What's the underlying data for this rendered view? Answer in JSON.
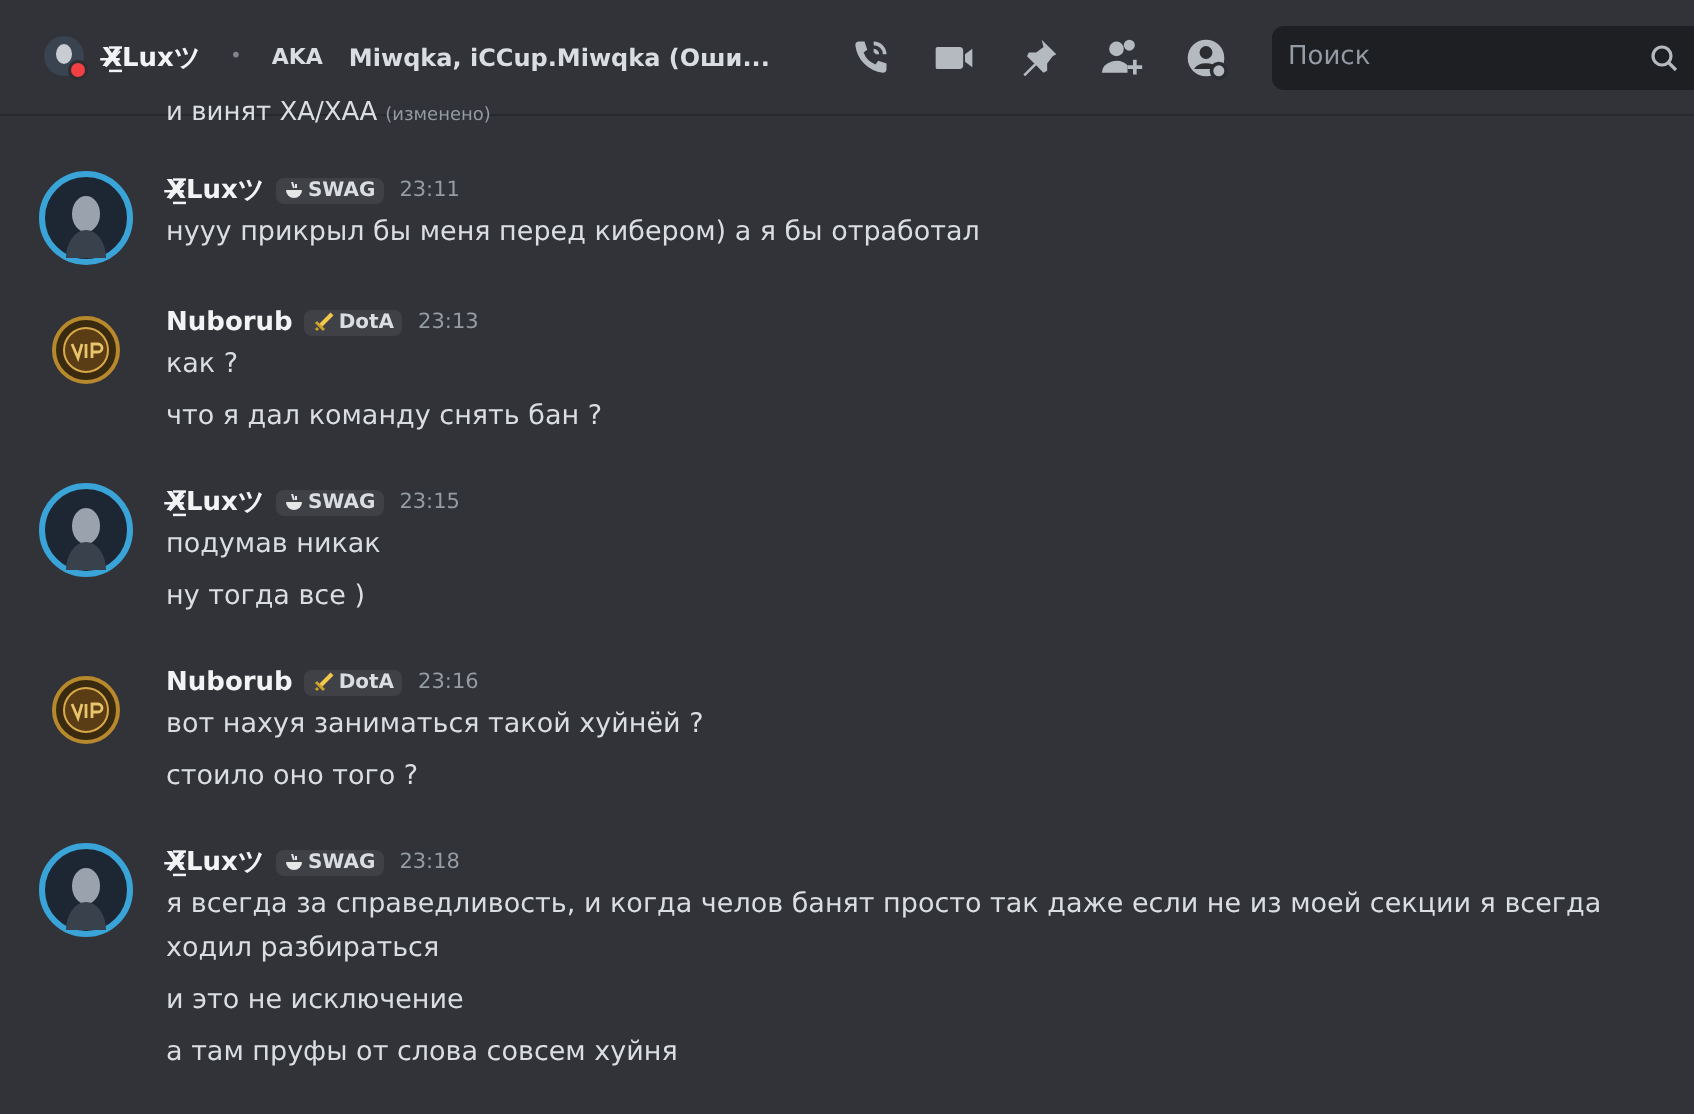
{
  "header": {
    "name": "X̶̷̲̅Luxツ",
    "status_dot": {
      "color": "#f23f43"
    },
    "separator": "•",
    "aka_label": "AKA",
    "aka_names": "Miwqka, iCCup.Miwqka (Оши...",
    "search": {
      "placeholder": "Поиск"
    }
  },
  "previous_line": {
    "text": "и винят ХА/ХАА",
    "edited": "(изменено)"
  },
  "messages": [
    {
      "kind": "girl",
      "author": "X̶̷̲̅Luxツ",
      "tag": {
        "kind": "bowl",
        "label": "SWAG"
      },
      "time": "23:11",
      "lines": [
        "нууу прикрыл бы меня перед кибером) а я бы отработал"
      ]
    },
    {
      "kind": "vip",
      "author": "Nuborub",
      "tag": {
        "kind": "sword",
        "label": "DotA"
      },
      "time": "23:13",
      "lines": [
        "как ?",
        "что я дал команду снять бан ?"
      ]
    },
    {
      "kind": "girl",
      "author": "X̶̷̲̅Luxツ",
      "tag": {
        "kind": "bowl",
        "label": "SWAG"
      },
      "time": "23:15",
      "lines": [
        "подумав никак",
        "ну тогда все )"
      ]
    },
    {
      "kind": "vip",
      "author": "Nuborub",
      "tag": {
        "kind": "sword",
        "label": "DotA"
      },
      "time": "23:16",
      "lines": [
        "вот нахуя заниматься такой хуйнёй ?",
        "стоило оно того ?"
      ]
    },
    {
      "kind": "girl",
      "author": "X̶̷̲̅Luxツ",
      "tag": {
        "kind": "bowl",
        "label": "SWAG"
      },
      "time": "23:18",
      "lines": [
        "я всегда за справедливость, и когда челов банят просто так даже если не из моей секции я всегда ходил разбираться",
        "и это не исключение",
        "а там пруфы от слова совсем хуйня"
      ]
    }
  ]
}
